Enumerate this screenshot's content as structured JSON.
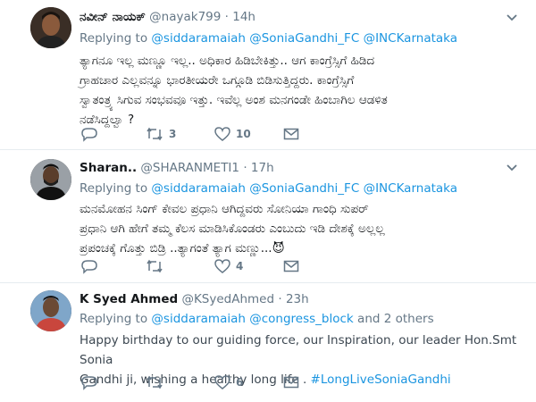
{
  "tweets": [
    {
      "name": "ನವೀನ್ ನಾಯಕ್",
      "handle": "@nayak799",
      "time": "14h",
      "replying_prefix": "Replying to",
      "mentions": [
        "@siddaramaiah",
        "@SoniaGandhi_FC",
        "@INCKarnataka"
      ],
      "and_others": "",
      "lines": [
        "ತ್ಯಾಗನೂ ಇಲ್ಲ ಮಣ್ಣೂ ಇಲ್ಲ.. ಅಧಿಕಾರ ಹಿಡಿಬೇಕಿತ್ತು.. ಆಗ ಕಾಂಗ್ರೆಸ್ಸಿಗೆ ಹಿಡಿದ",
        "ಗ್ರಾಹಚಾರ ಎಲ್ಲವನ್ನೂ ಭಾರತೀಯರೇ ಒಗ್ಗೂಡಿ ಬಿಡಿಸುತ್ತಿದ್ದರು. ಕಾಂಗ್ರೆಸ್ಸಿಗೆ",
        "ಸ್ವಾತಂತ್ರ್ಯ ಸಿಗುವ ಸಂಭವವೂ ಇತ್ತು. ಇವೆಲ್ಲ ಅಂಶ ಮನಗಂಡೇ ಹಿಂಬಾಗಿಲ ಆಡಳಿತ",
        "ನಡೆಸಿದ್ದಲ್ವಾ ?"
      ],
      "hashtag": "",
      "reply_count": "",
      "retweet_count": "3",
      "like_count": "10"
    },
    {
      "name": "Sharan..",
      "handle": "@SHARANMETI1",
      "time": "17h",
      "replying_prefix": "Replying to",
      "mentions": [
        "@siddaramaiah",
        "@SoniaGandhi_FC",
        "@INCKarnataka"
      ],
      "and_others": "",
      "lines": [
        "ಮನಮೋಹನ ಸಿಂಗ್ ಕೇವಲ ಪ್ರಧಾನಿ ಆಗಿದ್ದವರು ಸೋನಿಯಾ ಗಾಂಧಿ ಸುಪರ್",
        "ಪ್ರಧಾನಿ ಆಗಿ ಹೇಗೆ ತಮ್ಮ ಕೆಲಸ ಮಾಡಿಸಿಕೊಂಡರು ಎಂಬುದು ಇಡಿ ದೇಶಕ್ಕೆ ಅಲ್ಲಲ್ಲ",
        "ಪ್ರಪಂಚಕ್ಕೆ ಗೊತ್ತು ಬಿಡ್ರಿ ..ತ್ಯಾಗಂತೆ ತ್ಯಾಗ ಮಣ್ಣು...😈"
      ],
      "hashtag": "",
      "reply_count": "",
      "retweet_count": "",
      "like_count": "4"
    },
    {
      "name": "K Syed Ahmed",
      "handle": "@KSyedAhmed",
      "time": "23h",
      "replying_prefix": "Replying to",
      "mentions": [
        "@siddaramaiah",
        "@congress_block"
      ],
      "and_others": "and 2 others",
      "lines": [
        "Happy birthday to our guiding force, our Inspiration, our leader Hon.Smt Sonia",
        "Gandhi ji, wishing  a healthy long life ."
      ],
      "hashtag": "#LongLiveSoniaGandhi",
      "reply_count": "",
      "retweet_count": "",
      "like_count": "6"
    }
  ],
  "colors": {
    "link": "#1b95e0",
    "secondary": "#657786",
    "divider": "#e6ecf0"
  },
  "icons": [
    "reply-icon",
    "retweet-icon",
    "like-icon",
    "dm-icon",
    "chevron-down-icon"
  ]
}
